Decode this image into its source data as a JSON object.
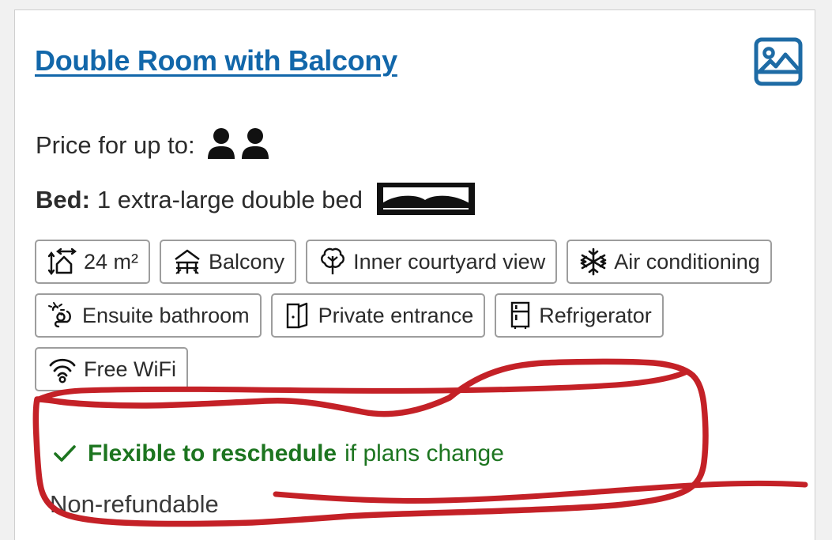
{
  "card": {
    "title": "Double Room with Balcony",
    "photo_icon": "image-photo-icon",
    "price_label": "Price for up to:",
    "occupancy_icons": [
      "person-icon",
      "person-icon"
    ],
    "bed_label": "Bed:",
    "bed_value": "1 extra-large double bed",
    "bed_icon": "double-bed-icon",
    "facilities": [
      {
        "icon": "room-size-icon",
        "label": "24 m²"
      },
      {
        "icon": "balcony-icon",
        "label": "Balcony"
      },
      {
        "icon": "tree-icon",
        "label": "Inner courtyard view"
      },
      {
        "icon": "snowflake-icon",
        "label": "Air conditioning"
      },
      {
        "icon": "shower-icon",
        "label": "Ensuite bathroom"
      },
      {
        "icon": "door-icon",
        "label": "Private entrance"
      },
      {
        "icon": "refrigerator-icon",
        "label": "Refrigerator"
      },
      {
        "icon": "wifi-icon",
        "label": "Free WiFi"
      }
    ],
    "policy": {
      "check_icon": "green-check-icon",
      "flexible_strong": "Flexible to reschedule",
      "flexible_rest": "if plans change",
      "non_refundable": "Non-refundable"
    },
    "annotation": {
      "shape": "red-hand-drawn-circle",
      "color": "#c42127"
    },
    "colors": {
      "link_blue": "#1267aa",
      "green": "#1d7520",
      "text": "#2b2b2b",
      "chip_border": "#9d9d9d",
      "page_bg": "#f1f1f1"
    }
  }
}
